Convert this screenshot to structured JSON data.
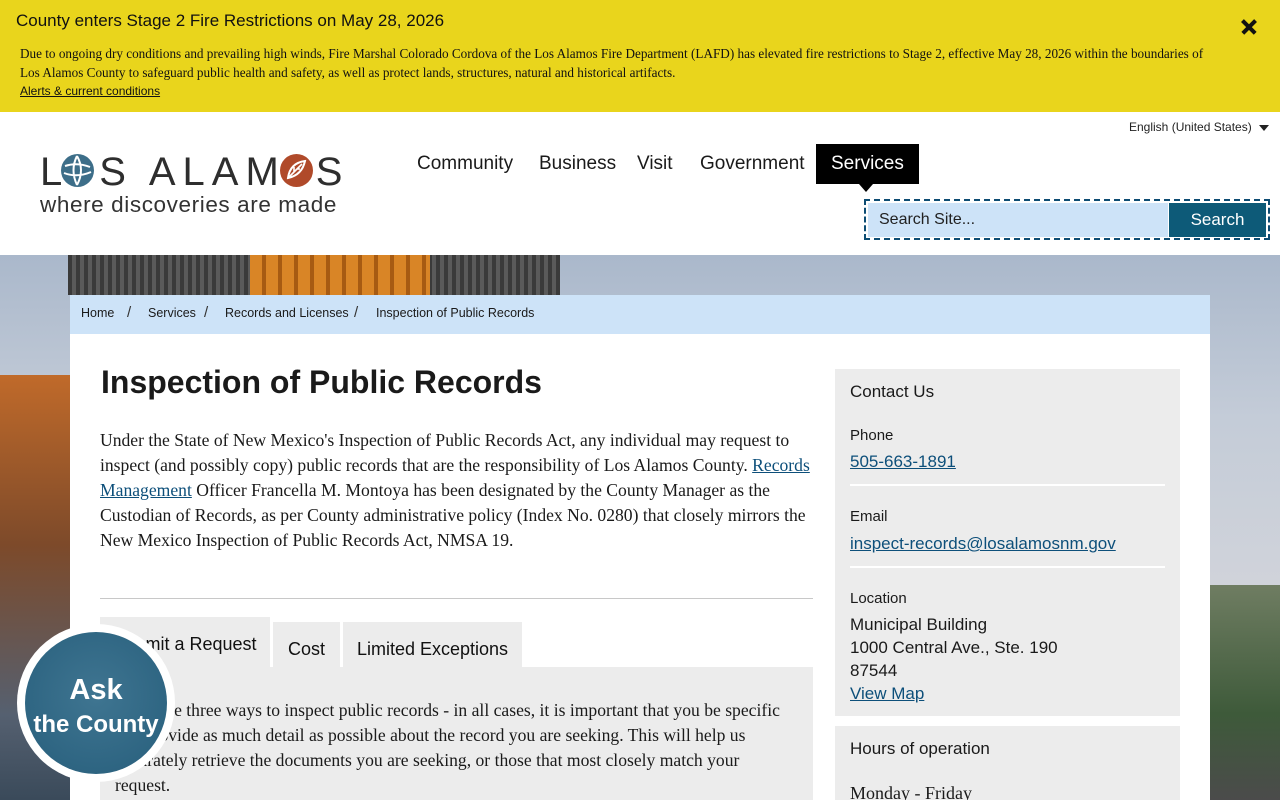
{
  "alert": {
    "title": "County enters Stage 2 Fire Restrictions on May 28, 2026",
    "body": "Due to ongoing dry conditions and prevailing high winds, Fire Marshal Colorado Cordova of the Los Alamos Fire Department (LAFD) has elevated fire restrictions to Stage 2, effective May 28, 2026 within the boundaries of Los Alamos County to safeguard public health and safety, as well as protect lands, structures, natural and historical artifacts.",
    "link": "Alerts & current conditions",
    "close_icon": "close-icon",
    "color": "#e9d51c"
  },
  "header": {
    "language": "English (United States)",
    "logo_word_left": "L",
    "logo_word_middle": "S ALAM",
    "logo_word_right": "S",
    "logo_tagline": "where discoveries are made",
    "nav": [
      "Community",
      "Business",
      "Visit",
      "Government",
      "Services"
    ],
    "active_nav": "Services",
    "search_placeholder": "Search Site...",
    "search_button": "Search",
    "accent": "#0d5a78"
  },
  "breadcrumb": [
    "Home",
    "Services",
    "Records and Licenses",
    "Inspection of Public Records"
  ],
  "breadcrumb_separator": "/",
  "main": {
    "title": "Inspection of Public Records",
    "intro_before_link": "Under the State of New Mexico's Inspection of Public Records Act, any individual may request to inspect (and possibly copy) public records that are the responsibility of Los Alamos County. ",
    "intro_link": "Records Management",
    "intro_after_link": " Officer Francella M. Montoya has been designated by the County Manager as the Custodian of Records, as per County administrative policy (Index No. 0280) that closely mirrors the New Mexico Inspection of Public Records Act, NMSA 19.",
    "tabs": [
      "Submit a Request",
      "Cost",
      "Limited Exceptions"
    ],
    "active_tab": "Submit a Request",
    "panel_text": "There are three ways to inspect public records - in all cases, it is important that you be specific and provide as much detail as possible about the record you are seeking. This will help us accurately retrieve the documents you are seeking, or those that most closely match your request."
  },
  "ask_badge": {
    "line1": "Ask",
    "line2": "the County"
  },
  "sidebar": {
    "contact_heading": "Contact Us",
    "phone_label": "Phone",
    "phone": "505-663-1891",
    "email_label": "Email",
    "email": "inspect-records@losalamosnm.gov",
    "location_label": "Location",
    "location_lines": [
      "Municipal Building",
      "1000 Central Ave., Ste. 190",
      "87544"
    ],
    "map_link": "View Map",
    "hours_heading": "Hours of operation",
    "hours_days": "Monday - Friday"
  }
}
